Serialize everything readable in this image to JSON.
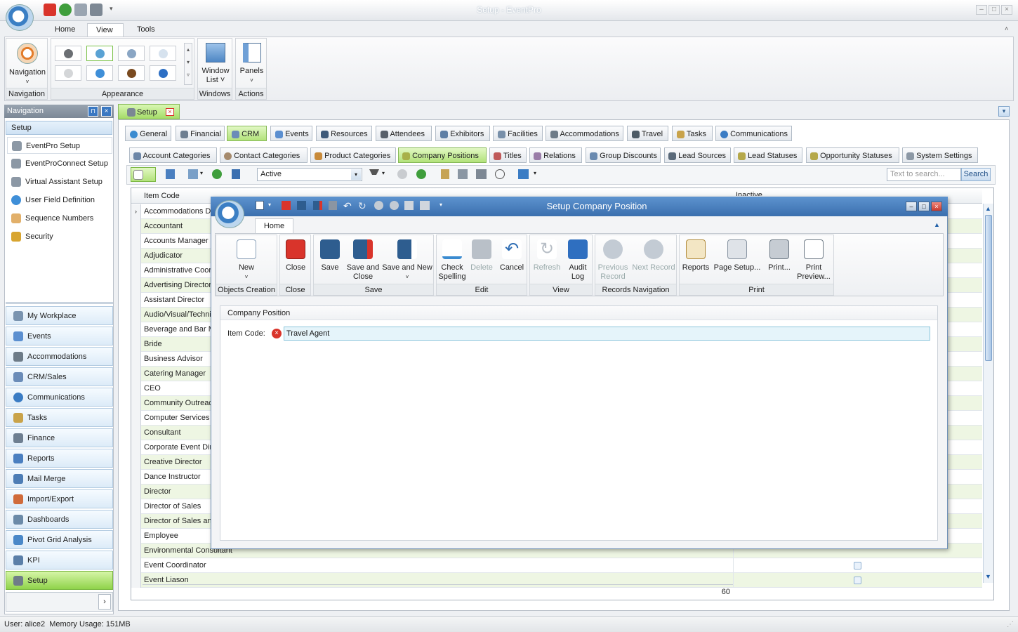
{
  "window": {
    "title": "Setup - EventPro"
  },
  "ribbon": {
    "tabs": [
      "Home",
      "View",
      "Tools"
    ],
    "selected_tab": "View",
    "groups": {
      "navigation": {
        "button": "Navigation",
        "label": "Navigation"
      },
      "appearance": {
        "label": "Appearance"
      },
      "windows": {
        "button_line1": "Window",
        "button_line2": "List",
        "label": "Windows"
      },
      "actions": {
        "button": "Panels",
        "label": "Actions"
      }
    }
  },
  "nav": {
    "header": "Navigation",
    "group": "Setup",
    "items": [
      "EventPro Setup",
      "EventProConnect Setup",
      "Virtual Assistant Setup",
      "User Field Definition",
      "Sequence Numbers",
      "Security"
    ],
    "modules": [
      "My Workplace",
      "Events",
      "Accommodations",
      "CRM/Sales",
      "Communications",
      "Tasks",
      "Finance",
      "Reports",
      "Mail Merge",
      "Import/Export",
      "Dashboards",
      "Pivot Grid Analysis",
      "KPI",
      "Setup"
    ],
    "selected_module": "Setup"
  },
  "doc": {
    "tab": "Setup",
    "top_tabs": [
      "General",
      "Financial",
      "CRM",
      "Events",
      "Resources",
      "Attendees",
      "Exhibitors",
      "Facilities",
      "Accommodations",
      "Travel",
      "Tasks",
      "Communications"
    ],
    "selected_top_tab": "CRM",
    "sub_tabs": [
      "Account Categories",
      "Contact Categories",
      "Product Categories",
      "Company Positions",
      "Titles",
      "Relations",
      "Group Discounts",
      "Lead Sources",
      "Lead Statuses",
      "Opportunity Statuses",
      "System Settings"
    ],
    "selected_sub_tab": "Company Positions",
    "filter": "Active",
    "search_placeholder": "Text to search...",
    "search_button": "Search"
  },
  "grid": {
    "columns": [
      "Item Code",
      "Inactive"
    ],
    "rows": [
      "Accommodations Di",
      "Accountant",
      "Accounts Manager",
      "Adjudicator",
      "Administrative Coor",
      "Advertising Director",
      "Assistant Director",
      "Audio/Visual/Techni",
      "Beverage and Bar M",
      "Bride",
      "Business Advisor",
      "Catering Manager",
      "CEO",
      "Community Outreac",
      "Computer Services",
      "Consultant",
      "Corporate Event Dir",
      "Creative Director",
      "Dance Instructor",
      "Director",
      "Director of Sales",
      "Director of Sales an",
      "Employee",
      "Environmental Consultant",
      "Event Coordinator",
      "Event Liason"
    ],
    "row_count": "60"
  },
  "dialog": {
    "title": "Setup Company Position",
    "tab": "Home",
    "groups": [
      {
        "label": "Objects Creation",
        "buttons": [
          {
            "label": "New",
            "sub": "",
            "disabled": false
          }
        ]
      },
      {
        "label": "Close",
        "buttons": [
          {
            "label": "Close",
            "sub": "",
            "disabled": false
          }
        ]
      },
      {
        "label": "Save",
        "buttons": [
          {
            "label": "Save",
            "sub": "",
            "disabled": false
          },
          {
            "label": "Save and",
            "sub": "Close",
            "disabled": false
          },
          {
            "label": "Save and New",
            "sub": "",
            "disabled": false
          }
        ]
      },
      {
        "label": "Edit",
        "buttons": [
          {
            "label": "Check",
            "sub": "Spelling",
            "disabled": false
          },
          {
            "label": "Delete",
            "sub": "",
            "disabled": true
          },
          {
            "label": "Cancel",
            "sub": "",
            "disabled": false
          }
        ]
      },
      {
        "label": "View",
        "buttons": [
          {
            "label": "Refresh",
            "sub": "",
            "disabled": true
          },
          {
            "label": "Audit",
            "sub": "Log",
            "disabled": false
          }
        ]
      },
      {
        "label": "Records Navigation",
        "buttons": [
          {
            "label": "Previous",
            "sub": "Record",
            "disabled": true
          },
          {
            "label": "Next Record",
            "sub": "",
            "disabled": true
          }
        ]
      },
      {
        "label": "Print",
        "buttons": [
          {
            "label": "Reports",
            "sub": "",
            "disabled": false
          },
          {
            "label": "Page Setup...",
            "sub": "",
            "disabled": false
          },
          {
            "label": "Print...",
            "sub": "",
            "disabled": false
          },
          {
            "label": "Print",
            "sub": "Preview...",
            "disabled": false
          }
        ]
      }
    ],
    "panel_title": "Company Position",
    "field_label": "Item Code:",
    "field_value": "Travel Agent"
  },
  "status": {
    "user": "User: alice2",
    "memory": "Memory Usage: 151MB"
  },
  "colors": {
    "accent_green": "#8fd34a",
    "dialog_title": "#3b6fae",
    "error_red": "#d9342b"
  }
}
